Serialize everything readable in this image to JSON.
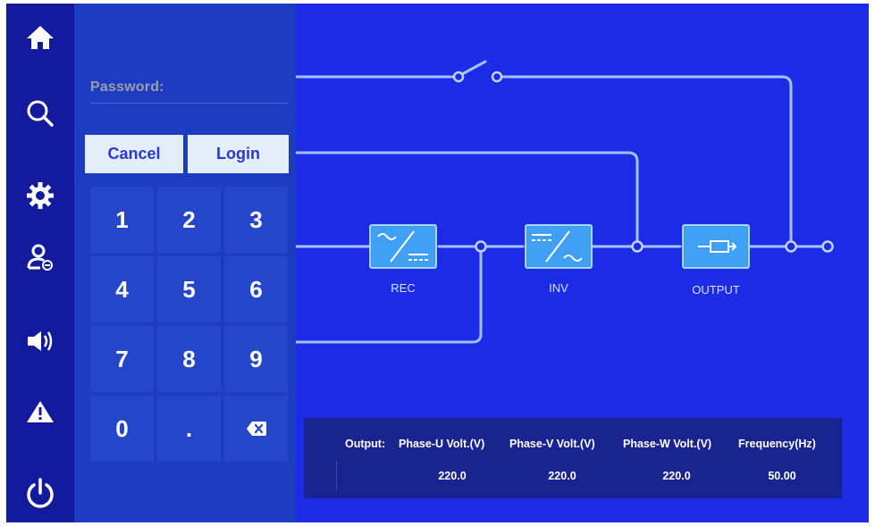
{
  "rail": {
    "icons": [
      "home-icon",
      "search-icon",
      "settings-gear-icon",
      "user-logout-icon",
      "speaker-icon",
      "warning-icon",
      "power-icon"
    ]
  },
  "login": {
    "password_label": "Password:",
    "password_value": "",
    "cancel_label": "Cancel",
    "login_label": "Login"
  },
  "keypad": {
    "keys": [
      "1",
      "2",
      "3",
      "4",
      "5",
      "6",
      "7",
      "8",
      "9",
      "0",
      "."
    ],
    "backspace_icon": "backspace-icon"
  },
  "diagram": {
    "blocks": [
      "REC",
      "INV",
      "OUTPUT"
    ],
    "bypass_switch": "open"
  },
  "readout": {
    "title": "Output:",
    "headers": [
      "Phase-U Volt.(V)",
      "Phase-V Volt.(V)",
      "Phase-W Volt.(V)",
      "Frequency(Hz)"
    ],
    "values": [
      "220.0",
      "220.0",
      "220.0",
      "50.00"
    ]
  },
  "colors": {
    "background": "#1b2be6",
    "rail": "#131b9c",
    "keypad": "#1e3cc2",
    "block": "#3fa0f4",
    "button": "#e4eefb"
  }
}
